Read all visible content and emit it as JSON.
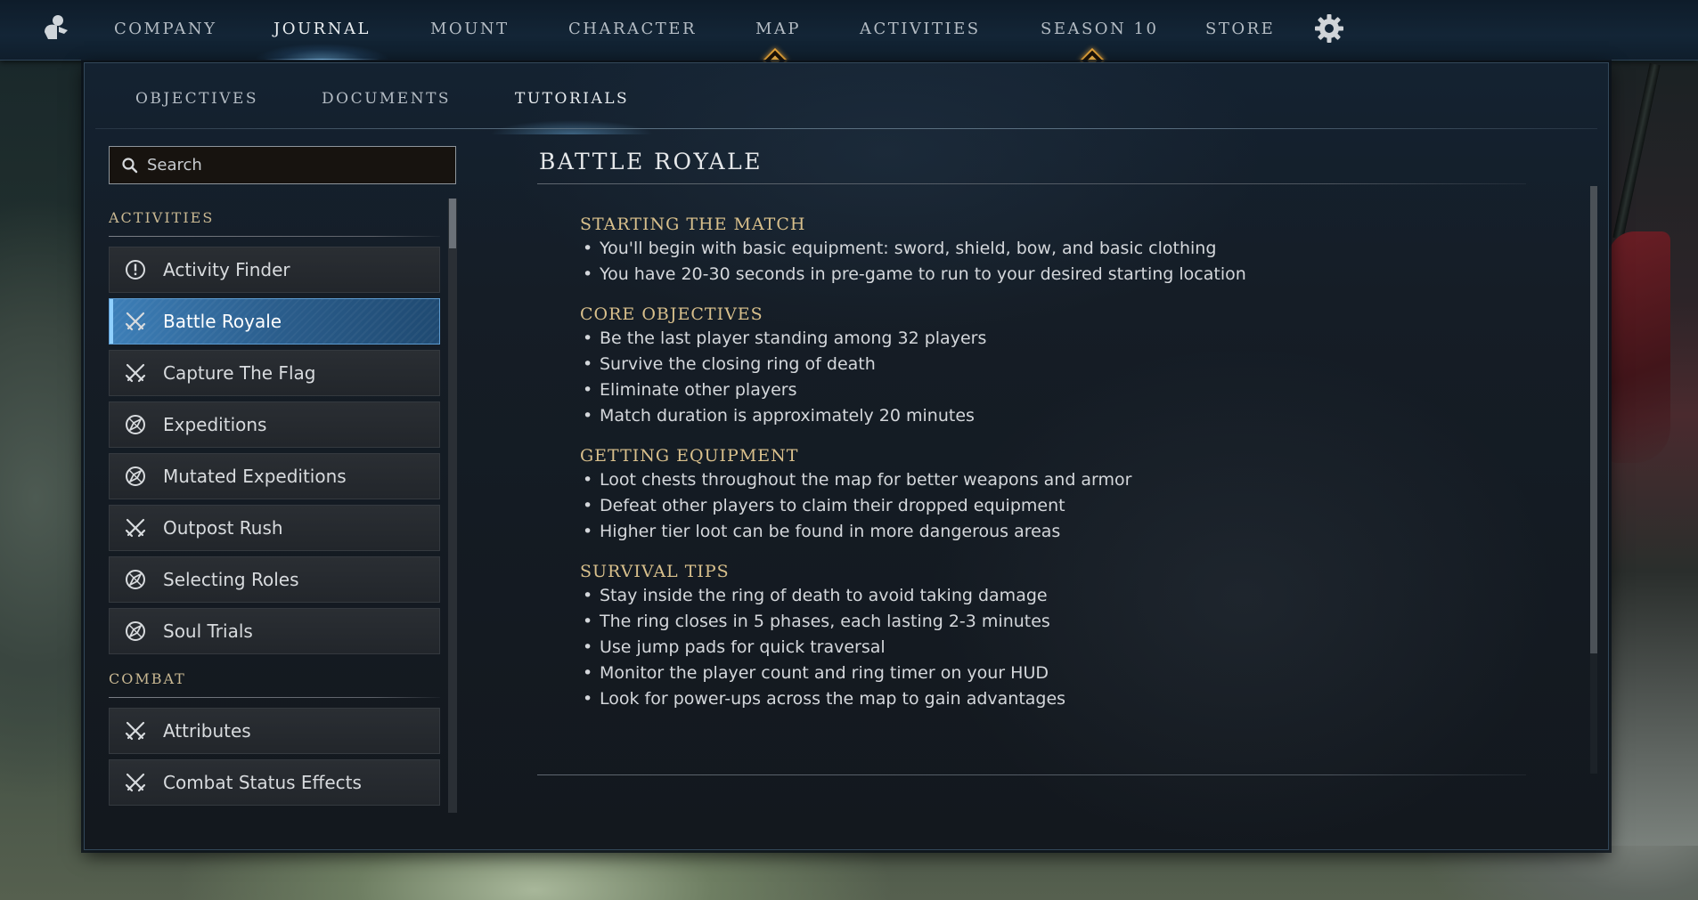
{
  "nav": {
    "tabs": [
      {
        "label": "COMPANY"
      },
      {
        "label": "JOURNAL"
      },
      {
        "label": "MOUNT"
      },
      {
        "label": "CHARACTER"
      },
      {
        "label": "MAP"
      },
      {
        "label": "ACTIVITIES"
      },
      {
        "label": "SEASON 10"
      },
      {
        "label": "STORE"
      }
    ],
    "active_tab": "JOURNAL",
    "notification_icons": [
      "diamond-notification-icon",
      "diamond-notification-icon"
    ],
    "settings_icon": "gear-icon"
  },
  "subtabs": [
    {
      "label": "OBJECTIVES"
    },
    {
      "label": "DOCUMENTS"
    },
    {
      "label": "TUTORIALS"
    }
  ],
  "active_subtab": "TUTORIALS",
  "search": {
    "placeholder": "Search",
    "value": ""
  },
  "sidebar": {
    "sections": [
      {
        "header": "ACTIVITIES",
        "items": [
          {
            "label": "Activity Finder",
            "icon": "exclamation-circle-icon"
          },
          {
            "label": "Battle Royale",
            "icon": "crossed-swords-icon",
            "selected": true
          },
          {
            "label": "Capture The Flag",
            "icon": "crossed-swords-icon"
          },
          {
            "label": "Expeditions",
            "icon": "compass-icon"
          },
          {
            "label": "Mutated Expeditions",
            "icon": "compass-icon"
          },
          {
            "label": "Outpost Rush",
            "icon": "crossed-swords-icon"
          },
          {
            "label": "Selecting Roles",
            "icon": "compass-icon"
          },
          {
            "label": "Soul Trials",
            "icon": "compass-icon"
          }
        ]
      },
      {
        "header": "COMBAT",
        "items": [
          {
            "label": "Attributes",
            "icon": "crossed-swords-icon"
          },
          {
            "label": "Combat Status Effects",
            "icon": "crossed-swords-icon"
          }
        ]
      }
    ]
  },
  "content": {
    "title": "BATTLE ROYALE",
    "sections": [
      {
        "title": "STARTING THE MATCH",
        "bullets": [
          "You'll begin with basic equipment: sword, shield, bow, and basic clothing",
          "You have 20-30 seconds in pre-game to run to your desired starting location"
        ]
      },
      {
        "title": "CORE OBJECTIVES",
        "bullets": [
          "Be the last player standing among 32 players",
          "Survive the closing ring of death",
          "Eliminate other players",
          "Match duration is approximately 20 minutes"
        ]
      },
      {
        "title": "GETTING EQUIPMENT",
        "bullets": [
          "Loot chests throughout the map for better weapons and armor",
          "Defeat other players to claim their dropped equipment",
          "Higher tier loot can be found in more dangerous areas"
        ]
      },
      {
        "title": "SURVIVAL TIPS",
        "bullets": [
          "Stay inside the ring of death to avoid taking damage",
          "The ring closes in 5 phases, each lasting 2-3 minutes",
          "Use jump pads for quick traversal",
          "Monitor the player count and ring timer on your HUD",
          "Look for power-ups across the map to gain advantages"
        ]
      }
    ]
  },
  "colors": {
    "accent_gold": "#d9c08c",
    "selected_blue": "#3d7fb8",
    "notification_orange": "#e0a23a"
  }
}
